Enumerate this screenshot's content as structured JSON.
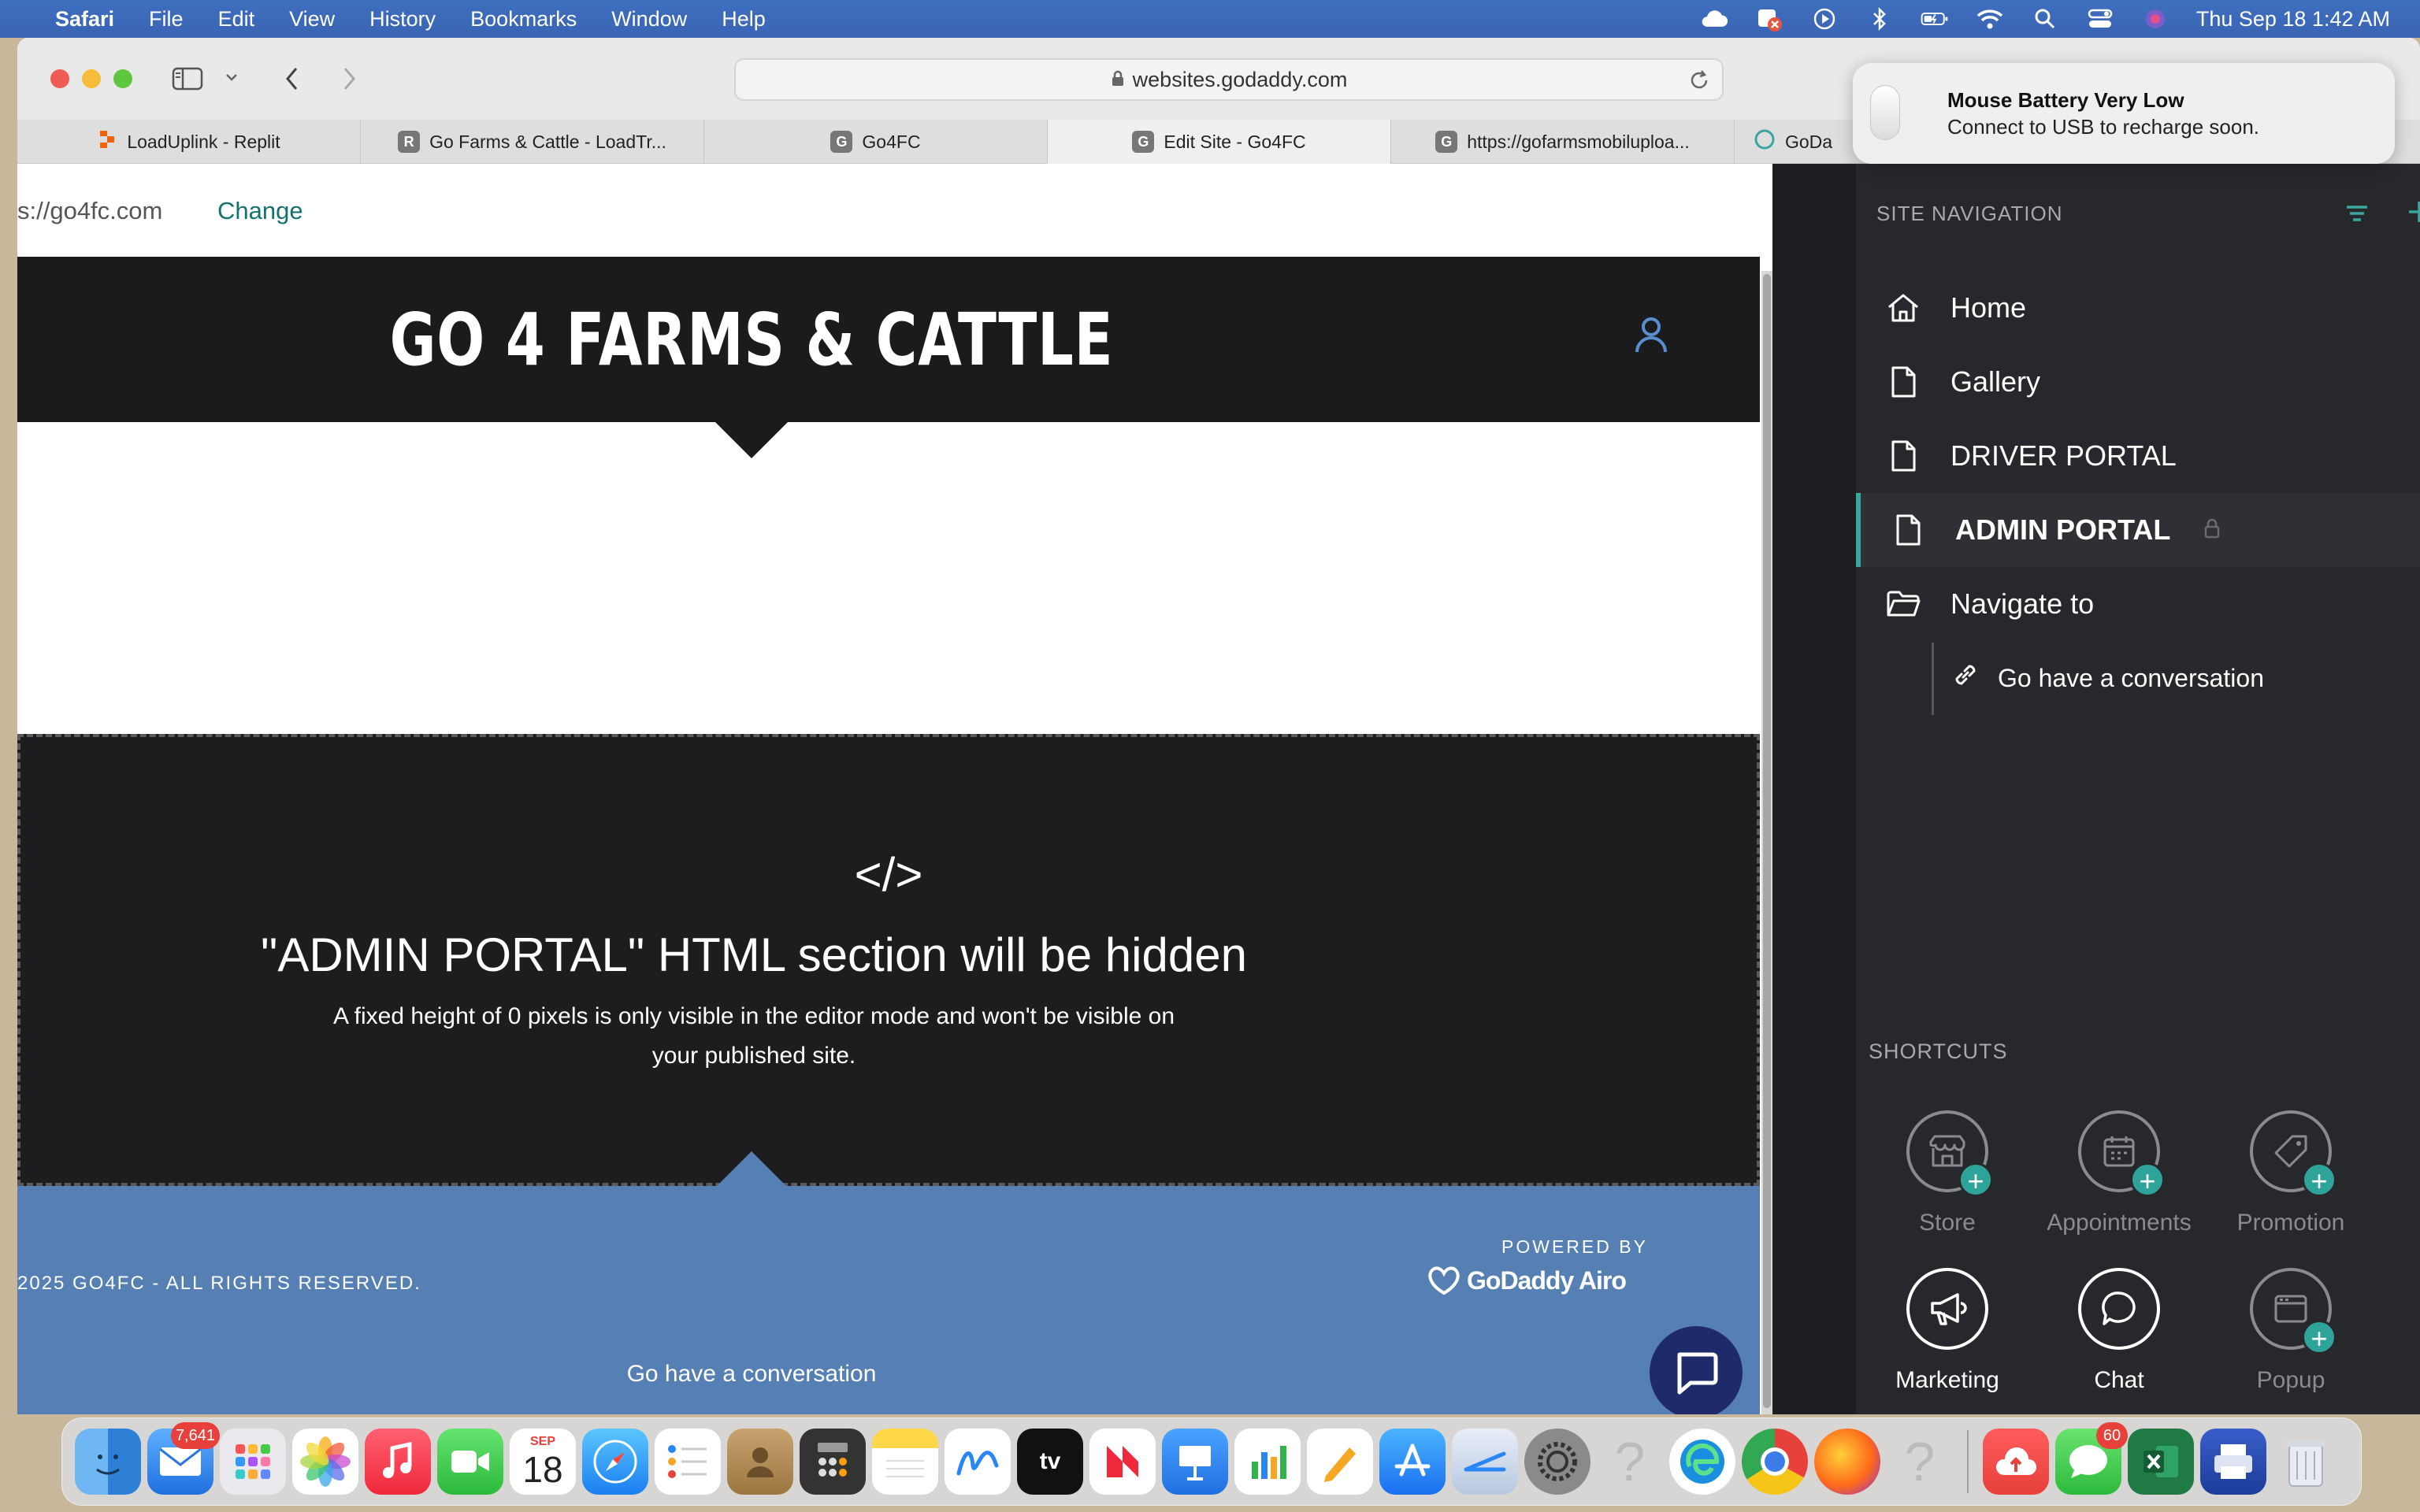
{
  "menubar": {
    "app": "Safari",
    "items": [
      "File",
      "Edit",
      "View",
      "History",
      "Bookmarks",
      "Window",
      "Help"
    ],
    "clock": "Thu Sep 18  1:42 AM"
  },
  "browser": {
    "url": "websites.godaddy.com",
    "tabs": [
      {
        "label": "LoadUplink - Replit",
        "icon": "R"
      },
      {
        "label": "Go Farms & Cattle - LoadTr...",
        "icon": "R"
      },
      {
        "label": "Go4FC",
        "icon": "G"
      },
      {
        "label": "Edit Site - Go4FC",
        "icon": "G"
      },
      {
        "label": "https://gofarmsmobiluploa...",
        "icon": "G"
      },
      {
        "label": "GoDa",
        "icon": "G"
      }
    ]
  },
  "notification": {
    "title": "Mouse Battery Very Low",
    "body": "Connect to USB to recharge soon."
  },
  "site": {
    "domain": "s://go4fc.com",
    "change_label": "Change",
    "title": "GO 4 FARMS & CATTLE",
    "html_glyph": "</>",
    "hidden_title": "\"ADMIN PORTAL\" HTML section will be hidden",
    "hidden_desc_1": "A fixed height of 0 pixels is only visible in the editor mode and won't be visible on",
    "hidden_desc_2": "your published site.",
    "copyright": "2025 GO4FC - ALL RIGHTS RESERVED.",
    "powered_by": "POWERED BY",
    "powered_brand": "GoDaddy Airo",
    "footer_link": "Go have a conversation"
  },
  "panel": {
    "heading": "SITE NAVIGATION",
    "nav": [
      {
        "label": "Home",
        "icon": "home-icon"
      },
      {
        "label": "Gallery",
        "icon": "page-icon"
      },
      {
        "label": "DRIVER PORTAL",
        "icon": "page-icon"
      },
      {
        "label": "ADMIN PORTAL",
        "icon": "page-icon",
        "selected": true,
        "locked": true
      },
      {
        "label": "Navigate to",
        "icon": "folder-icon"
      }
    ],
    "sublink": "Go have a conversation",
    "shortcuts_heading": "SHORTCUTS",
    "shortcuts": [
      {
        "label": "Store",
        "icon": "store-icon",
        "active": false
      },
      {
        "label": "Appointments",
        "icon": "calendar-icon",
        "active": false
      },
      {
        "label": "Promotion",
        "icon": "tag-icon",
        "active": false
      },
      {
        "label": "Marketing",
        "icon": "megaphone-icon",
        "active": true
      },
      {
        "label": "Chat",
        "icon": "chat-icon",
        "active": true
      },
      {
        "label": "Popup",
        "icon": "popup-icon",
        "active": false
      }
    ]
  },
  "dock": {
    "mail_badge": "7,641",
    "calendar_month": "SEP",
    "calendar_day": "18",
    "tv_label": "tv",
    "messages_badge": "60"
  },
  "colors": {
    "header_bg": "#1b1b1d",
    "footer_bg": "#5680b4",
    "accent_teal": "#2ea39a",
    "chat_bubble": "#1e2a6a",
    "menubar": "#3f6fbf"
  }
}
